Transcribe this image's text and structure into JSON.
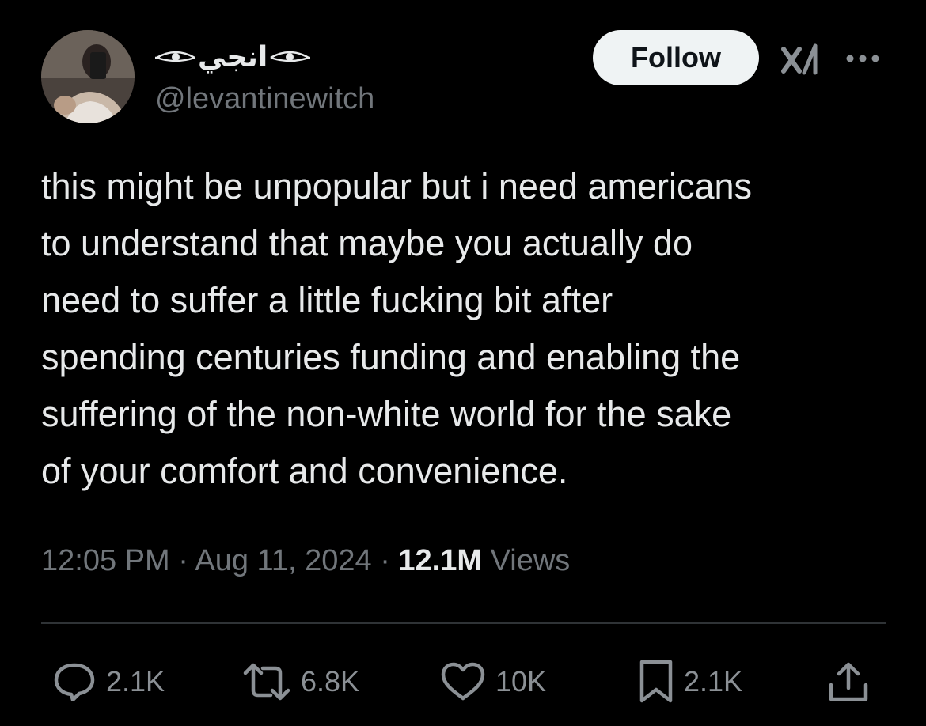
{
  "author": {
    "display_name": "انجي",
    "handle": "@levantinewitch",
    "avatar_icon": "profile-photo",
    "name_decoration_icon": "eye-icon"
  },
  "header": {
    "follow_label": "Follow",
    "grok_icon": "grok-icon",
    "more_icon": "more-dots-icon"
  },
  "tweet": {
    "lines": [
      "this might be unpopular but i need americans",
      "to understand that maybe you actually do",
      "need to suffer a little fucking bit after",
      "spending centuries funding and enabling the",
      "suffering of the non-white world for the sake",
      "of your comfort and convenience."
    ]
  },
  "meta": {
    "time": "12:05 PM",
    "separator": "·",
    "date": "Aug 11, 2024",
    "views_count": "12.1M",
    "views_label": "Views"
  },
  "actions": {
    "replies": "2.1K",
    "reposts": "6.8K",
    "likes": "10K",
    "bookmarks": "2.1K"
  },
  "colors": {
    "background": "#000000",
    "text_primary": "#e7e9ea",
    "text_secondary": "#71767b",
    "divider": "#2f3336",
    "follow_bg": "#eff3f4"
  }
}
